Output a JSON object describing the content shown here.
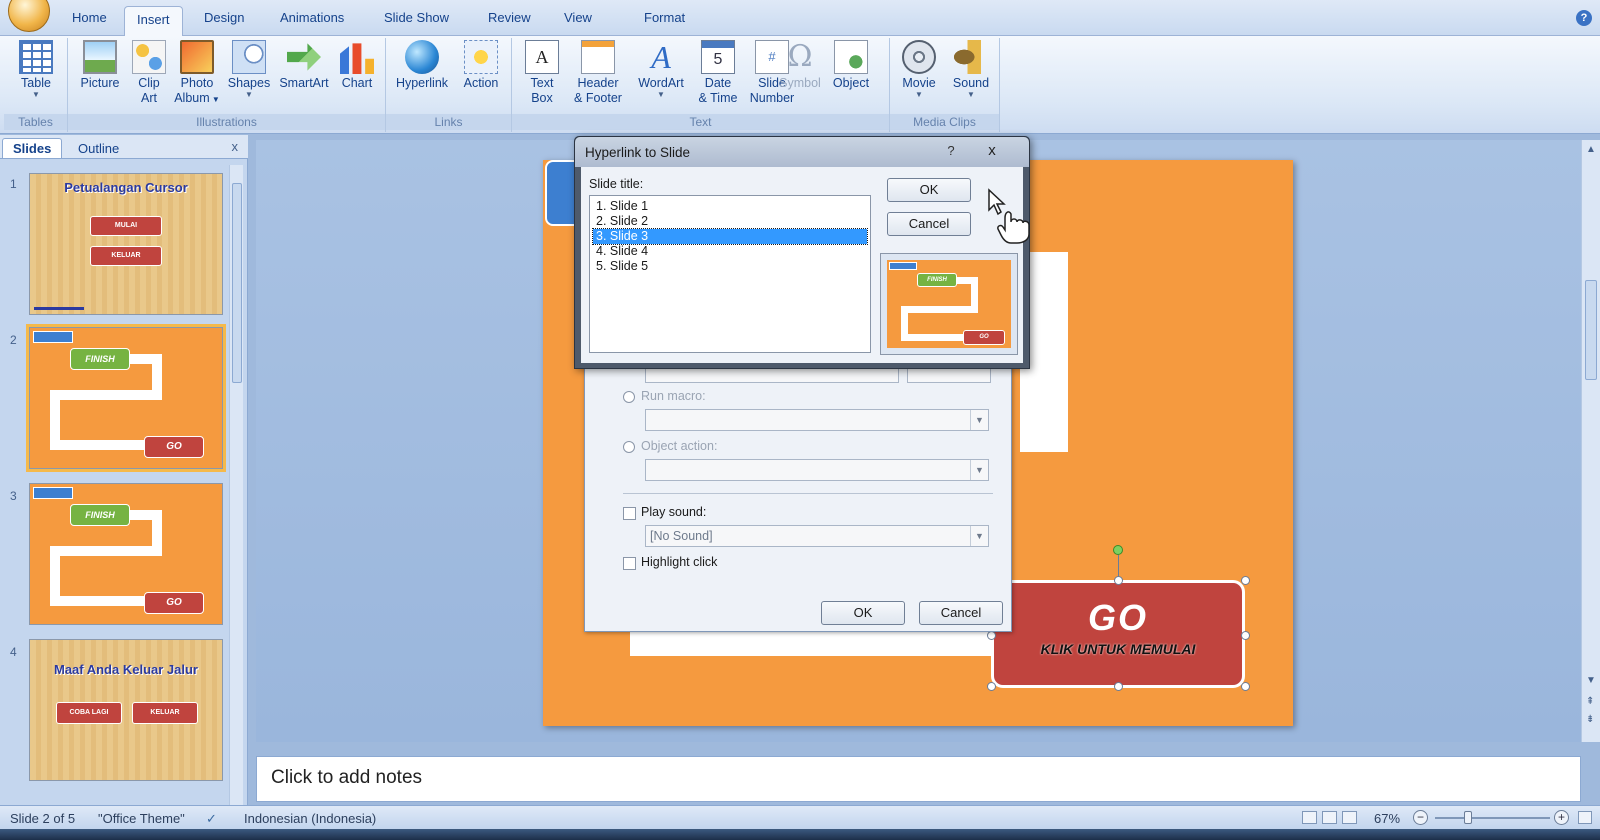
{
  "ribbon": {
    "tabs": [
      "Home",
      "Insert",
      "Design",
      "Animations",
      "Slide Show",
      "Review",
      "View",
      "Format"
    ],
    "active_tab": "Insert",
    "groups": {
      "tables": {
        "label": "Tables",
        "buttons": {
          "table": "Table"
        }
      },
      "illustrations": {
        "label": "Illustrations",
        "buttons": {
          "picture": "Picture",
          "clip_art_1": "Clip",
          "clip_art_2": "Art",
          "photo_album_1": "Photo",
          "photo_album_2": "Album",
          "shapes": "Shapes",
          "smartart": "SmartArt",
          "chart": "Chart"
        }
      },
      "links": {
        "label": "Links",
        "buttons": {
          "hyperlink": "Hyperlink",
          "action": "Action"
        }
      },
      "text": {
        "label": "Text",
        "buttons": {
          "text_box_1": "Text",
          "text_box_2": "Box",
          "header_footer_1": "Header",
          "header_footer_2": "& Footer",
          "wordart": "WordArt",
          "date_time_1": "Date",
          "date_time_2": "& Time",
          "slide_number_1": "Slide",
          "slide_number_2": "Number",
          "symbol": "Symbol",
          "object": "Object"
        }
      },
      "media": {
        "label": "Media Clips",
        "buttons": {
          "movie": "Movie",
          "sound": "Sound"
        }
      }
    }
  },
  "icons": {
    "textbox_glyph": "A",
    "date_glyph": "5",
    "slidenum_glyph": "#",
    "symbol_glyph": "Ω",
    "wordart_glyph": "A",
    "help_glyph": "?",
    "close_glyph": "x"
  },
  "left_panel": {
    "tabs": [
      "Slides",
      "Outline"
    ],
    "active_tab": "Slides",
    "close": "x",
    "slides": [
      {
        "num": "1",
        "title": "Petualangan Cursor",
        "buttons": [
          "MULAI",
          "KELUAR"
        ]
      },
      {
        "num": "2",
        "finish": "FINISH",
        "go": "GO"
      },
      {
        "num": "3",
        "finish": "FINISH",
        "go": "GO"
      },
      {
        "num": "4",
        "title": "Maaf Anda Keluar Jalur",
        "buttons": [
          "COBA LAGI",
          "KELUAR"
        ]
      }
    ]
  },
  "slide": {
    "go_title": "GO",
    "go_subtitle": "KLIK UNTUK MEMULAI"
  },
  "action_dialog": {
    "run_macro": "Run macro:",
    "object_action": "Object action:",
    "play_sound": "Play sound:",
    "sound_value": "[No Sound]",
    "highlight_click": "Highlight click",
    "ok": "OK",
    "cancel": "Cancel"
  },
  "hyperlink_dialog": {
    "title": "Hyperlink to Slide",
    "help": "?",
    "close": "x",
    "list_label": "Slide title:",
    "items": [
      "1. Slide 1",
      "2. Slide 2",
      "3. Slide 3",
      "4. Slide 4",
      "5. Slide 5"
    ],
    "selected": "3. Slide 3",
    "ok": "OK",
    "cancel": "Cancel",
    "preview": {
      "finish": "FINISH",
      "go": "GO"
    }
  },
  "notes": {
    "placeholder": "Click to add notes"
  },
  "statusbar": {
    "slide_info": "Slide 2 of 5",
    "theme": "\"Office Theme\"",
    "language": "Indonesian (Indonesia)",
    "zoom": "67%",
    "zoom_minus": "−",
    "zoom_plus": "+"
  },
  "colors": {
    "slide_orange": "#f59a3f",
    "go_red": "#c0443e",
    "finish_green": "#76b342",
    "selection_blue": "#3399ff"
  }
}
